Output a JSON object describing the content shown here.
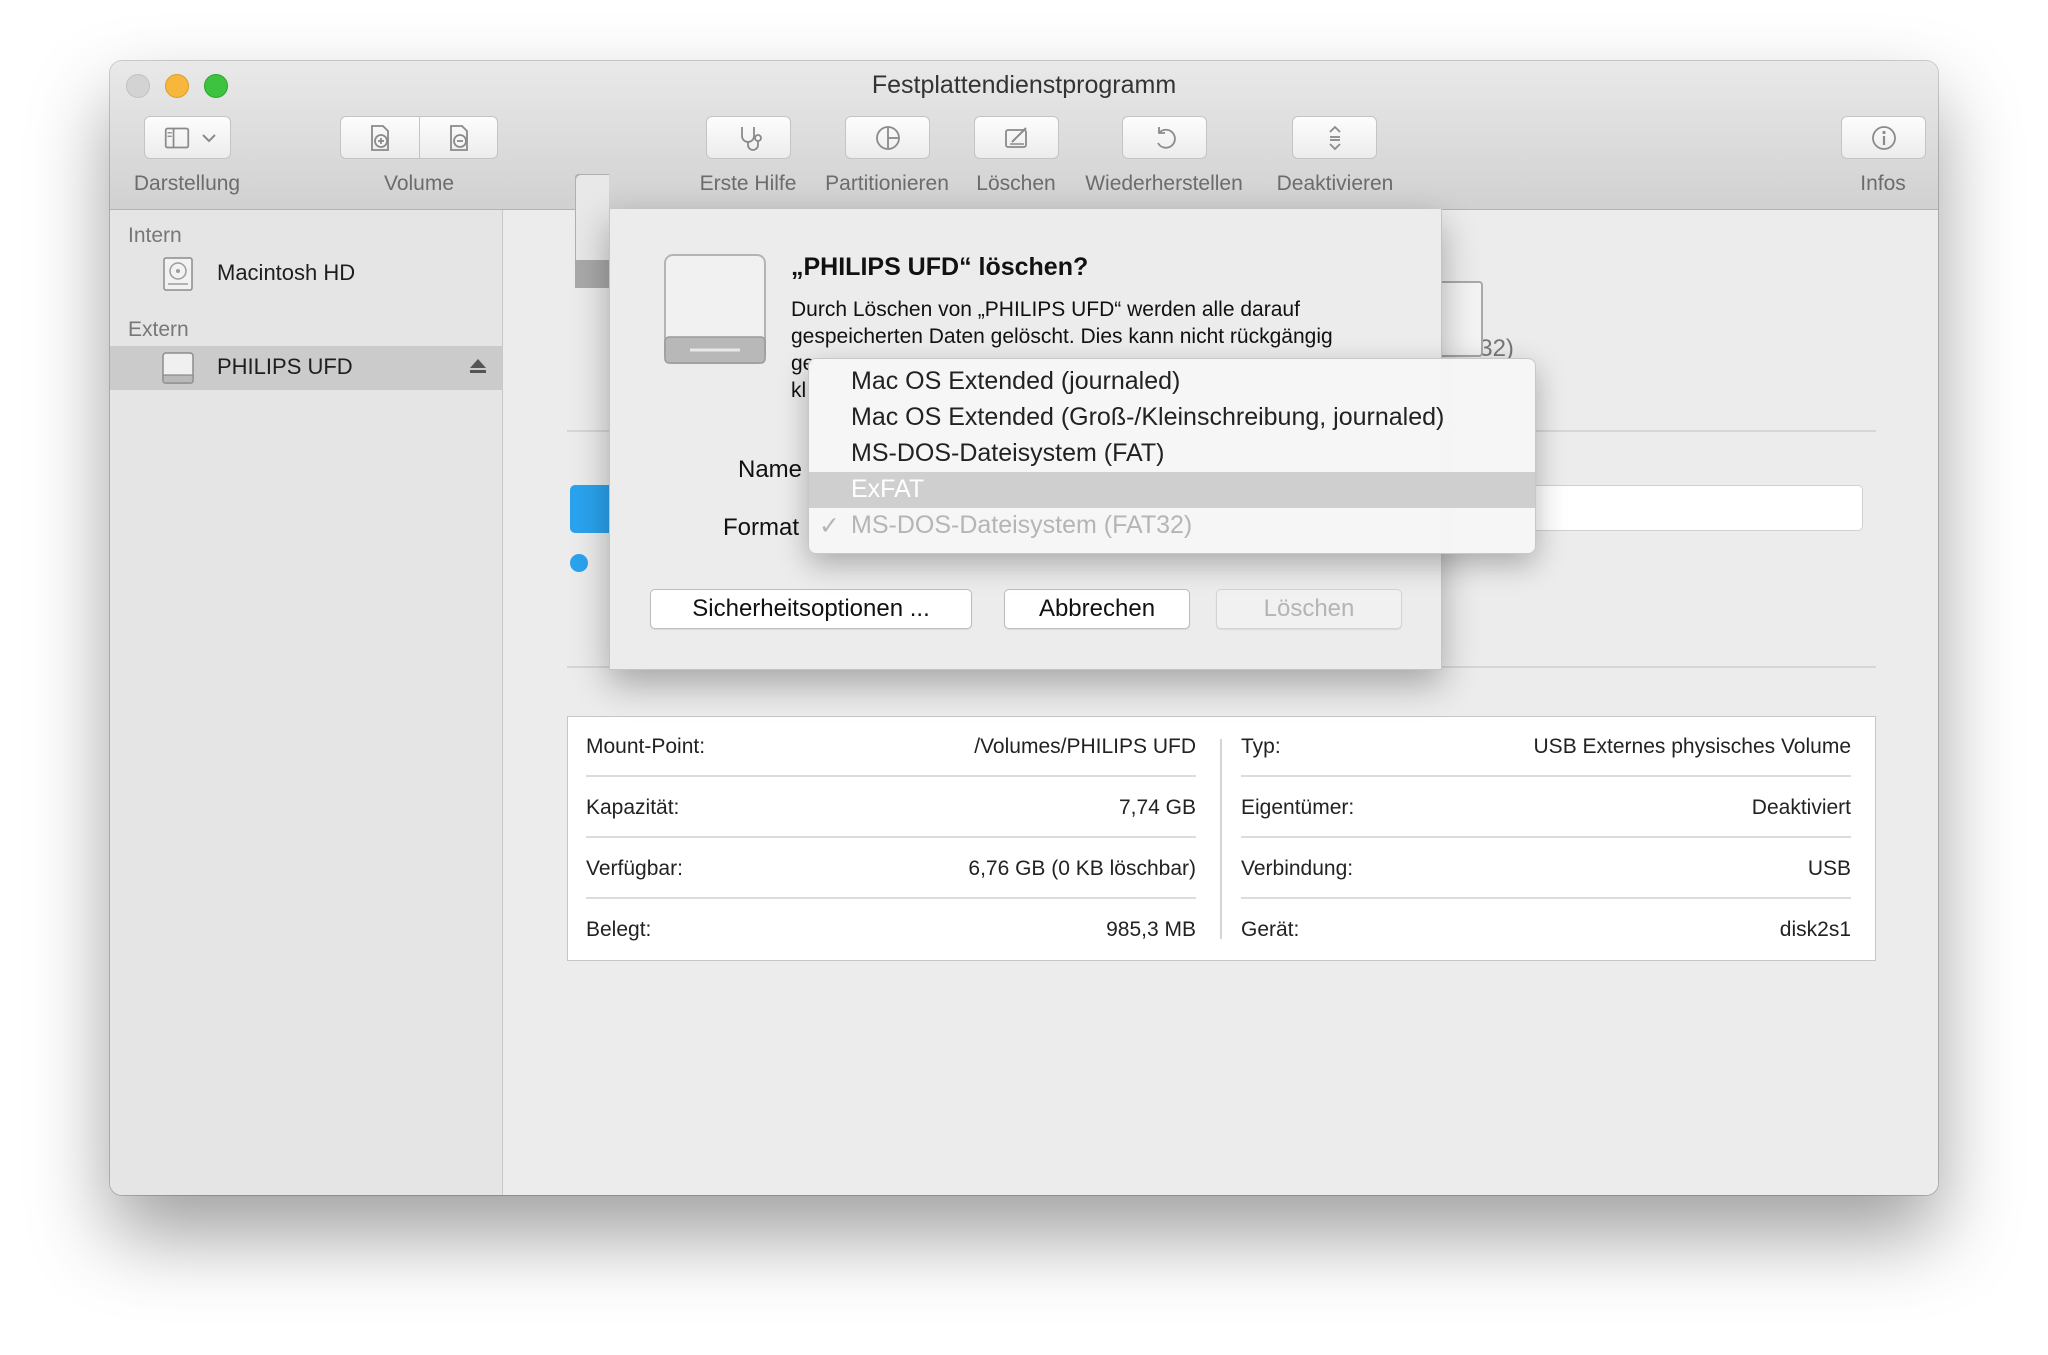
{
  "window": {
    "title": "Festplattendienstprogramm"
  },
  "toolbar": {
    "view_label": "Darstellung",
    "volume_label": "Volume",
    "first_aid_label": "Erste Hilfe",
    "partition_label": "Partitionieren",
    "erase_label": "Löschen",
    "restore_label": "Wiederherstellen",
    "unmount_label": "Deaktivieren",
    "info_label": "Infos"
  },
  "sidebar": {
    "sections": [
      {
        "title": "Intern",
        "items": [
          {
            "label": "Macintosh HD",
            "icon": "internal-disk-icon"
          }
        ]
      },
      {
        "title": "Extern",
        "items": [
          {
            "label": "PHILIPS UFD",
            "icon": "external-disk-icon",
            "selected": true
          }
        ]
      }
    ]
  },
  "main": {
    "capacity": "7,74 GB",
    "format_partial": "FAT32)",
    "info": {
      "left": [
        {
          "key": "Mount-Point:",
          "value": "/Volumes/PHILIPS UFD"
        },
        {
          "key": "Kapazität:",
          "value": "7,74 GB"
        },
        {
          "key": "Verfügbar:",
          "value": "6,76 GB (0 KB löschbar)"
        },
        {
          "key": "Belegt:",
          "value": "985,3 MB"
        }
      ],
      "right": [
        {
          "key": "Typ:",
          "value": "USB Externes physisches Volume"
        },
        {
          "key": "Eigentümer:",
          "value": "Deaktiviert"
        },
        {
          "key": "Verbindung:",
          "value": "USB"
        },
        {
          "key": "Gerät:",
          "value": "disk2s1"
        }
      ]
    }
  },
  "sheet": {
    "title": "„PHILIPS UFD“ löschen?",
    "desc_lines": [
      "Durch Löschen von „PHILIPS UFD“ werden alle darauf",
      "gespeicherten Daten gelöscht. Dies kann nicht rückgängig",
      "ge",
      "kl"
    ],
    "name_label": "Name",
    "format_label": "Format",
    "security_button": "Sicherheitsoptionen ...",
    "cancel_button": "Abbrechen",
    "erase_button": "Löschen"
  },
  "format_menu": {
    "items": [
      {
        "label": "Mac OS Extended (journaled)"
      },
      {
        "label": "Mac OS Extended (Groß-/Kleinschreibung, journaled)"
      },
      {
        "label": "MS-DOS-Dateisystem (FAT)"
      },
      {
        "label": "ExFAT",
        "highlighted": true
      },
      {
        "label": "MS-DOS-Dateisystem (FAT32)",
        "checked": true,
        "disabled": true
      }
    ],
    "checkmark": "✓"
  },
  "colors": {
    "accent_blue": "#2aa3ee",
    "highlight": "#cfcfcf"
  }
}
